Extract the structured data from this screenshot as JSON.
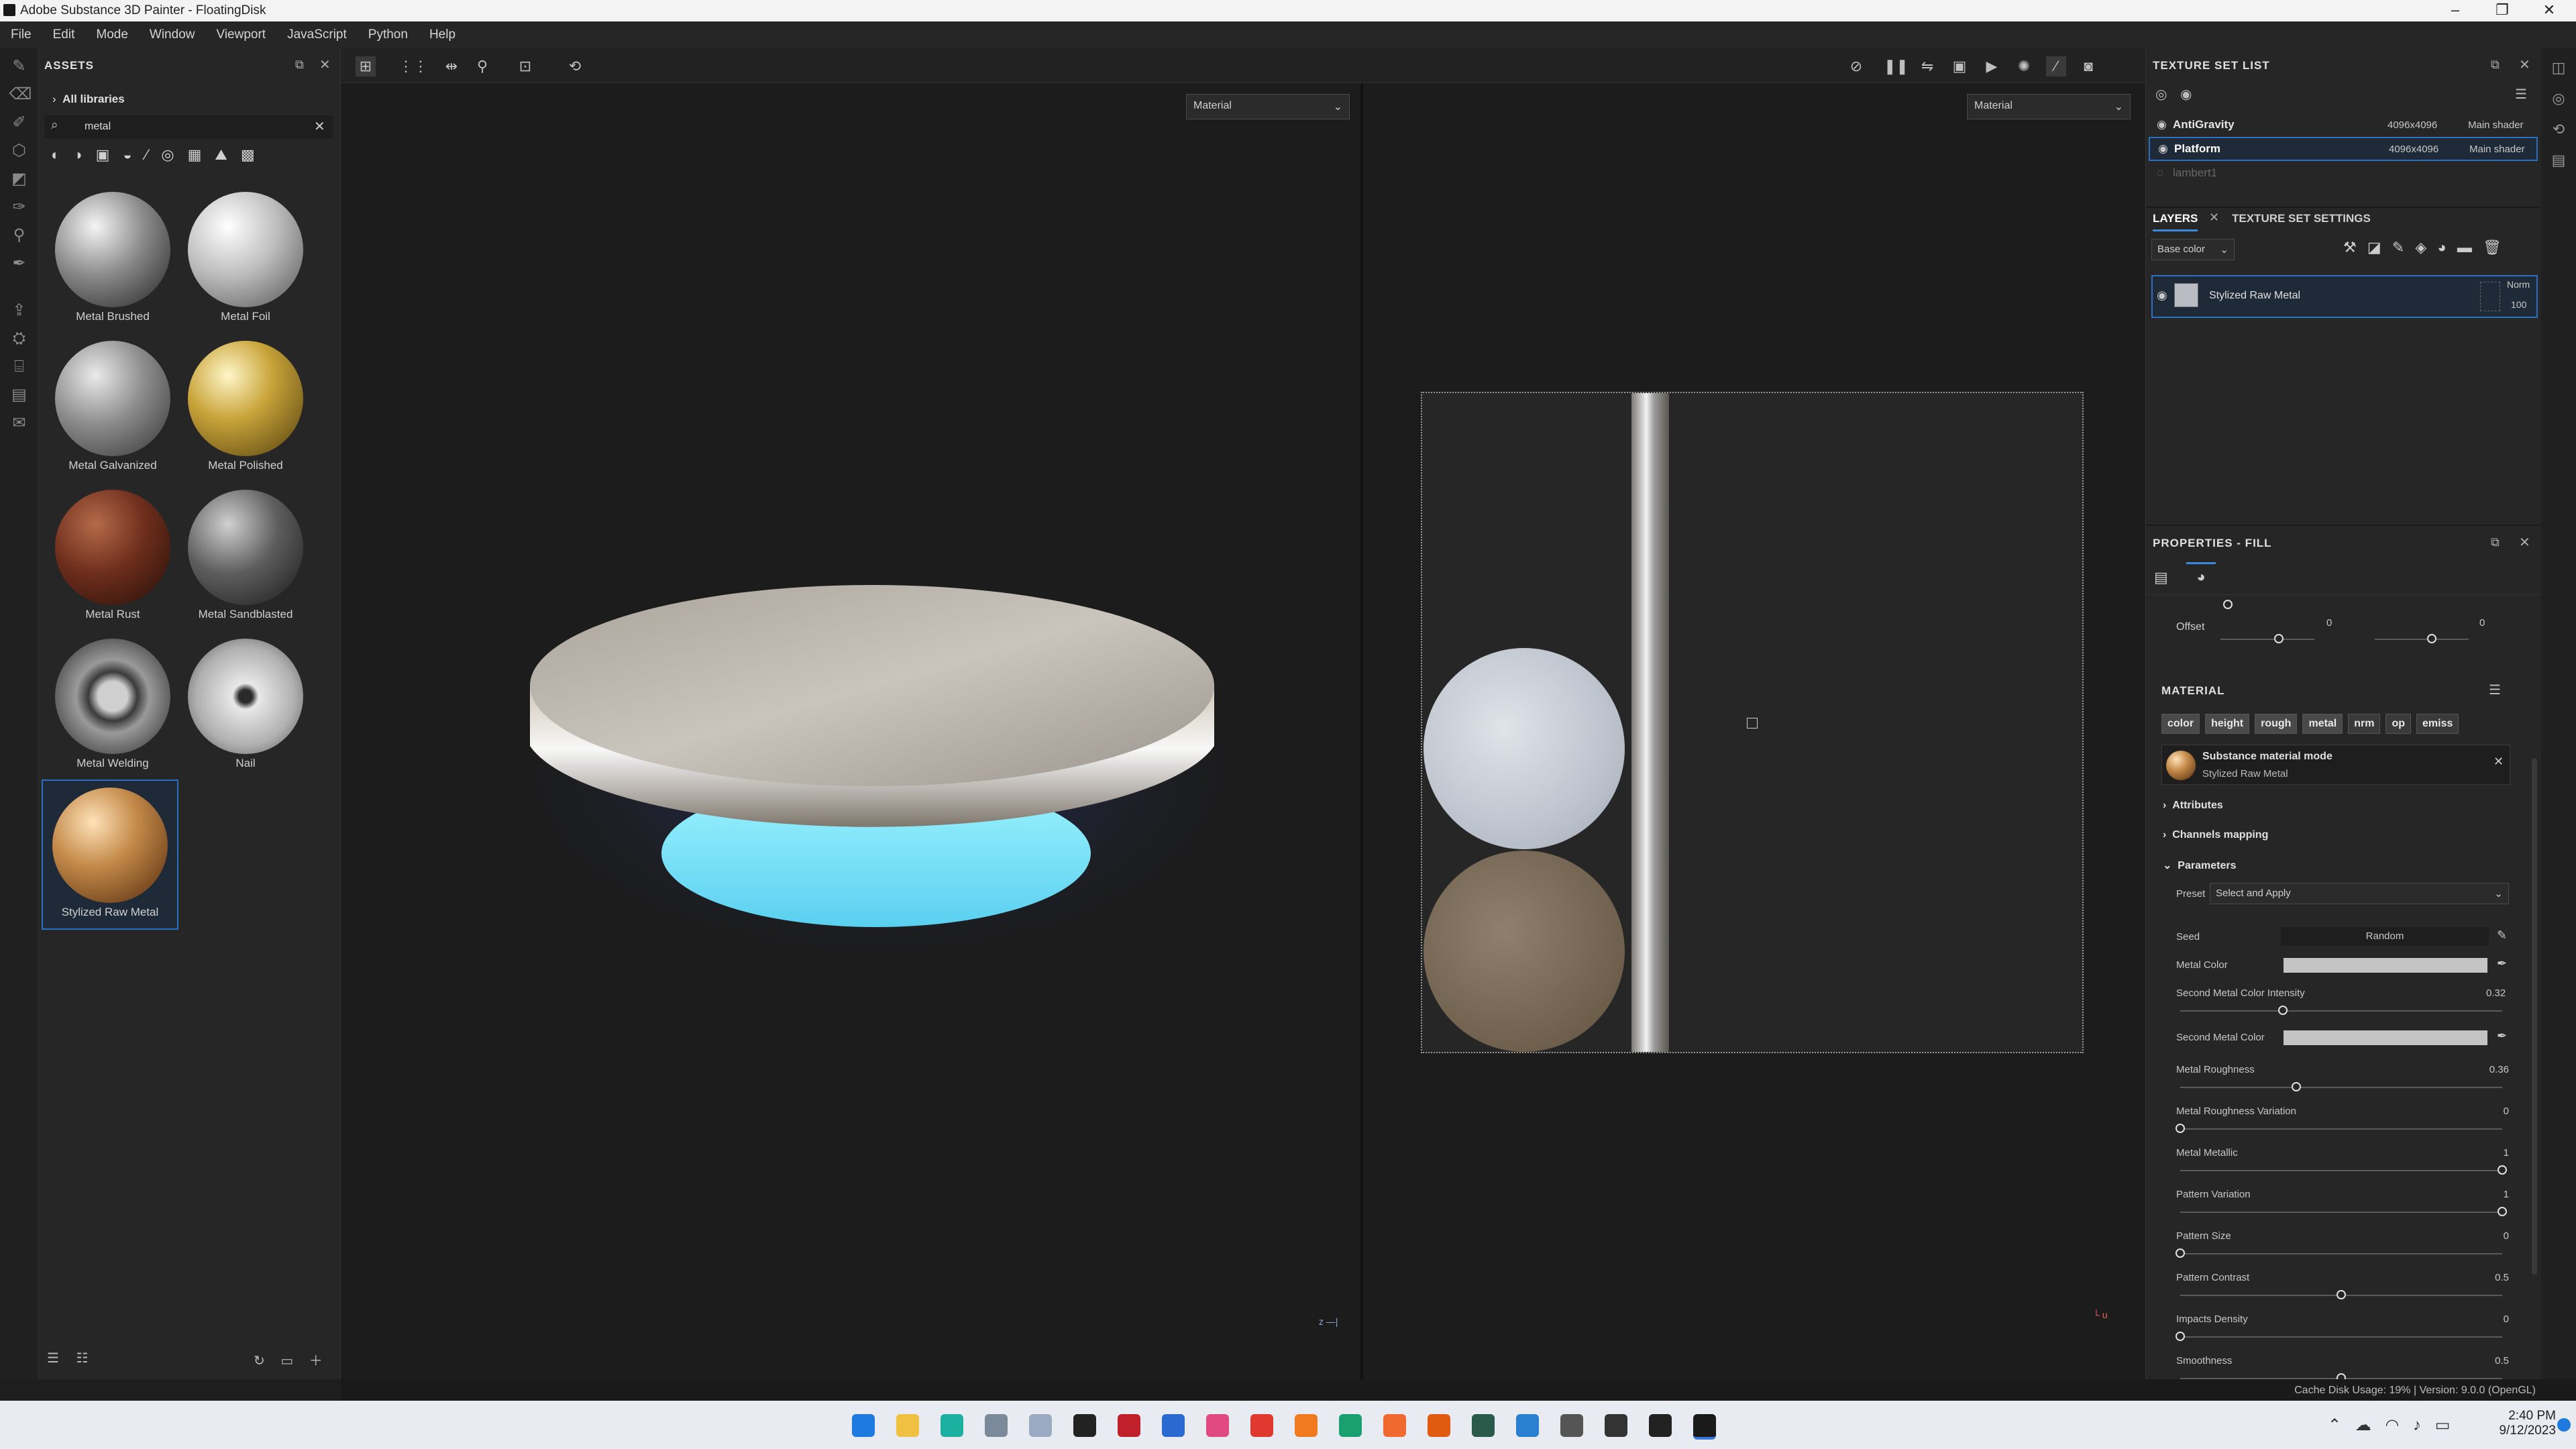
{
  "window": {
    "title": "Adobe Substance 3D Painter - FloatingDisk"
  },
  "menu": [
    "File",
    "Edit",
    "Mode",
    "Window",
    "Viewport",
    "JavaScript",
    "Python",
    "Help"
  ],
  "assets": {
    "title": "ASSETS",
    "library": "All libraries",
    "search_value": "metal",
    "items": [
      {
        "label": "Metal Brushed"
      },
      {
        "label": "Metal Foil"
      },
      {
        "label": "Metal Galvanized"
      },
      {
        "label": "Metal Polished"
      },
      {
        "label": "Metal Rust"
      },
      {
        "label": "Metal Sandblasted"
      },
      {
        "label": "Metal Welding"
      },
      {
        "label": "Nail"
      },
      {
        "label": "Stylized Raw Metal"
      }
    ]
  },
  "viewport": {
    "left_mode": "Material",
    "right_mode": "Material"
  },
  "texture_set_list": {
    "title": "TEXTURE SET LIST",
    "rows": [
      {
        "name": "AntiGravity",
        "res": "4096x4096",
        "shader": "Main shader"
      },
      {
        "name": "Platform",
        "res": "4096x4096",
        "shader": "Main shader"
      },
      {
        "name": "lambert1",
        "res": "",
        "shader": ""
      }
    ]
  },
  "layers": {
    "tab_layers": "LAYERS",
    "tab_settings": "TEXTURE SET SETTINGS",
    "channel": "Base color",
    "layer_name": "Stylized Raw Metal",
    "blend": "Norm",
    "opacity": "100"
  },
  "properties": {
    "title": "PROPERTIES - FILL",
    "offset_label": "Offset",
    "offset_a": "0",
    "offset_b": "0",
    "material_title": "MATERIAL",
    "channels": [
      "color",
      "height",
      "rough",
      "metal",
      "nrm",
      "op",
      "emiss"
    ],
    "substance_mode": "Substance material mode",
    "substance_name": "Stylized Raw Metal",
    "attributes": "Attributes",
    "channels_mapping": "Channels mapping",
    "parameters": "Parameters",
    "preset_label": "Preset",
    "preset_value": "Select and Apply",
    "seed_label": "Seed",
    "seed_value": "Random",
    "metal_color_label": "Metal Color",
    "second_intensity_label": "Second Metal Color Intensity",
    "second_intensity_value": "0.32",
    "second_color_label": "Second Metal Color",
    "sliders": [
      {
        "label": "Metal Roughness",
        "value": "0.36",
        "frac": 0.36
      },
      {
        "label": "Metal Roughness Variation",
        "value": "0",
        "frac": 0
      },
      {
        "label": "Metal Metallic",
        "value": "1",
        "frac": 1
      },
      {
        "label": "Pattern Variation",
        "value": "1",
        "frac": 1
      },
      {
        "label": "Pattern Size",
        "value": "0",
        "frac": 0
      },
      {
        "label": "Pattern Contrast",
        "value": "0.5",
        "frac": 0.5
      },
      {
        "label": "Impacts Density",
        "value": "0",
        "frac": 0
      },
      {
        "label": "Smoothness",
        "value": "0.5",
        "frac": 0.5
      }
    ]
  },
  "status": {
    "text": "Cache Disk Usage:  19% | Version: 9.0.0 (OpenGL)"
  },
  "taskbar": {
    "time": "2:40 PM",
    "date": "9/12/2023"
  }
}
